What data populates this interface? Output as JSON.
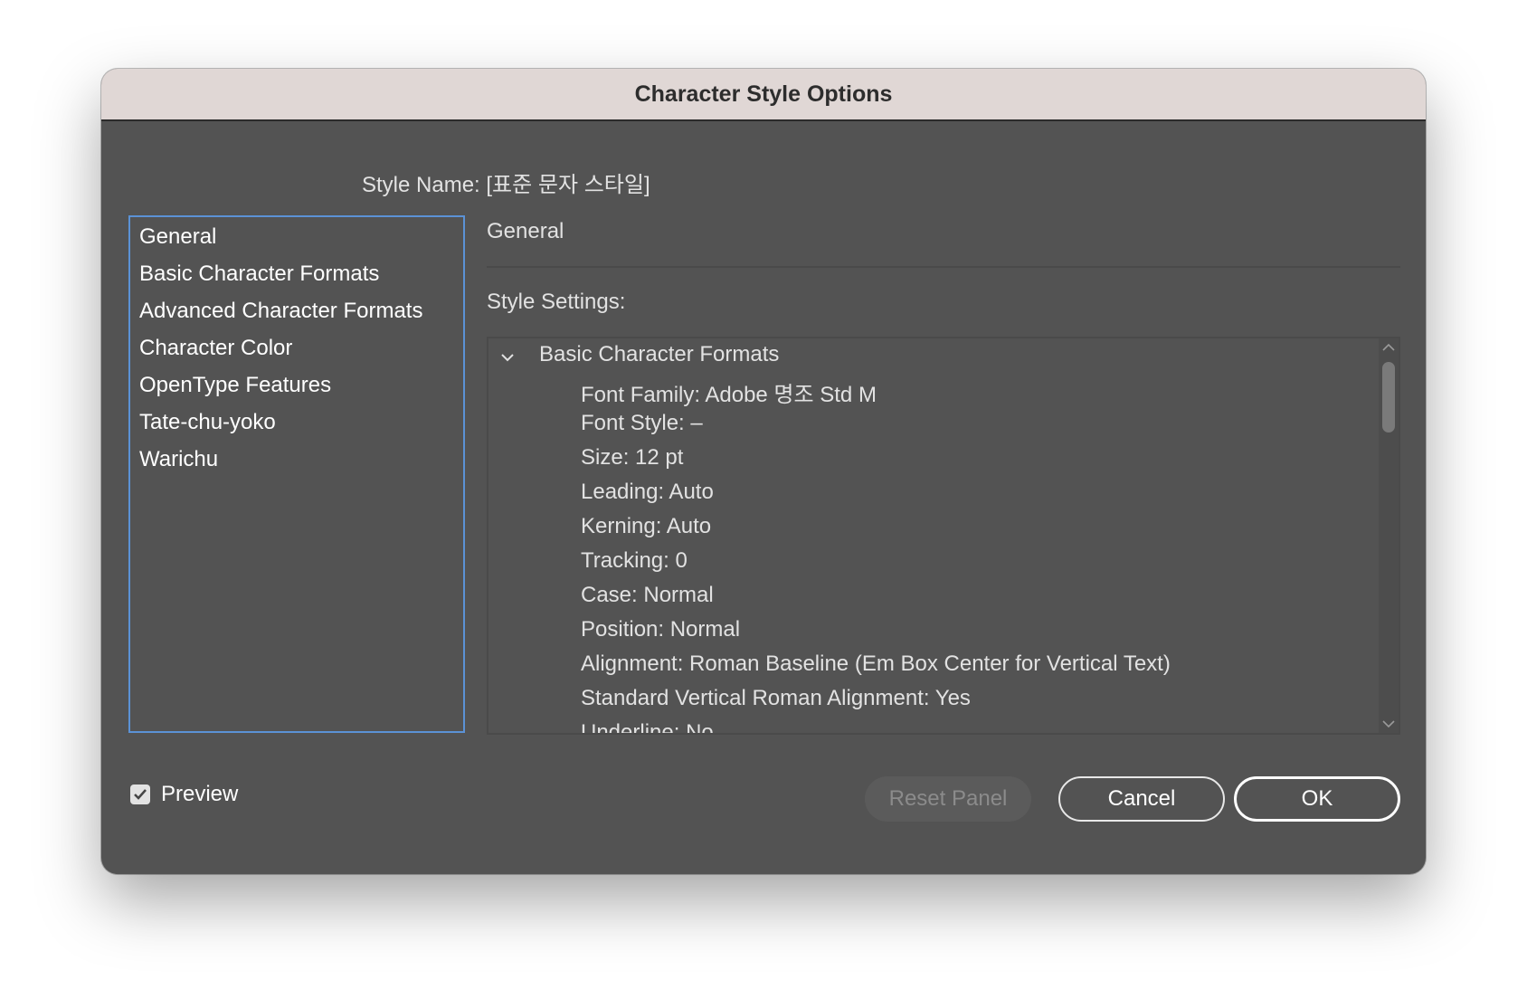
{
  "dialog": {
    "title": "Character Style Options"
  },
  "style_name": {
    "label": "Style Name: [표준 문자 스타일]"
  },
  "nav": {
    "items": [
      {
        "label": "General"
      },
      {
        "label": "Basic Character Formats"
      },
      {
        "label": "Advanced Character Formats"
      },
      {
        "label": "Character Color"
      },
      {
        "label": "OpenType Features"
      },
      {
        "label": "Tate-chu-yoko"
      },
      {
        "label": "Warichu"
      }
    ]
  },
  "panel": {
    "section_title": "General",
    "settings_label": "Style Settings:",
    "group_title": "Basic Character Formats",
    "settings": [
      "Font Family: Adobe 명조 Std M",
      "Font Style: –",
      "Size: 12 pt",
      "Leading: Auto",
      "Kerning: Auto",
      "Tracking: 0",
      "Case: Normal",
      "Position: Normal",
      "Alignment: Roman Baseline (Em Box Center for Vertical Text)",
      "Standard Vertical Roman Alignment: Yes",
      "Underline: No"
    ]
  },
  "footer": {
    "preview_label": "Preview",
    "preview_checked": true,
    "reset_label": "Reset Panel",
    "cancel_label": "Cancel",
    "ok_label": "OK"
  },
  "colors": {
    "dialog_bg": "#535353",
    "titlebar_bg": "#e0d7d5",
    "focus_border": "#5b92d6"
  },
  "icons": {
    "group_toggle": "chevron-down-icon",
    "scroll_up": "chevron-up-icon",
    "scroll_down": "chevron-down-icon",
    "preview_check": "checkmark-icon"
  }
}
